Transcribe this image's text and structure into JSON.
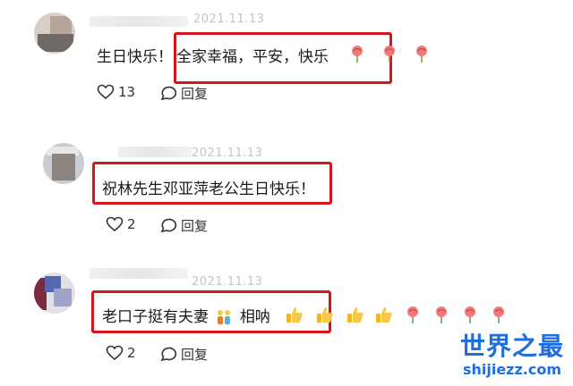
{
  "comments": [
    {
      "date": "2021.11.13",
      "text_prefix": "生日快乐！",
      "text_boxed": "全家幸福，平安，快乐",
      "emojis": [
        "rose-icon",
        "rose-icon",
        "rose-icon"
      ],
      "likes": "13",
      "reply_label": "回复"
    },
    {
      "date": "2021.11.13",
      "text": "祝林先生邓亚萍老公生日快乐！",
      "likes": "2",
      "reply_label": "回复"
    },
    {
      "date": "2021.11.13",
      "text_a": "老口子挺有夫妻",
      "text_b": "相呐",
      "emojis": [
        "thumbs-up-icon",
        "thumbs-up-icon",
        "thumbs-up-icon",
        "thumbs-up-icon",
        "rose-icon",
        "rose-icon",
        "rose-icon",
        "rose-icon"
      ],
      "likes": "2",
      "reply_label": "回复"
    }
  ],
  "watermark": {
    "title": "世界之最",
    "url": "shijiezz.com"
  },
  "colors": {
    "highlight": "#d8141b",
    "watermark": "#1d6fe0"
  }
}
